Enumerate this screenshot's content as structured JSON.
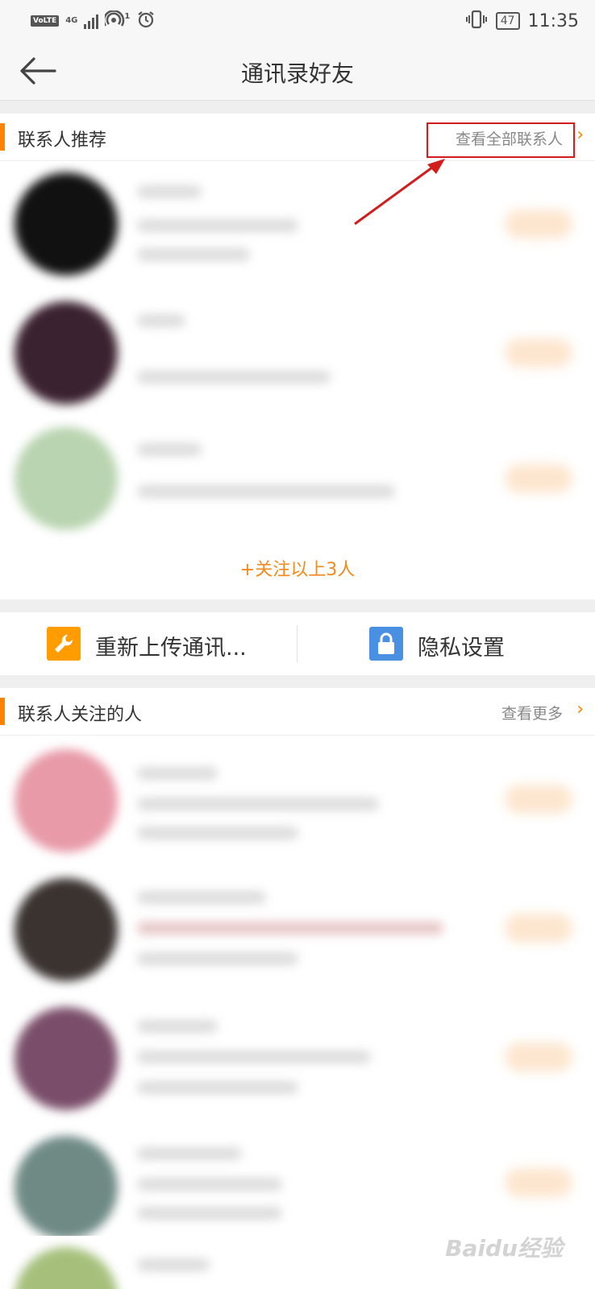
{
  "status_bar": {
    "volte": "VoLTE",
    "network": "4G",
    "hotspot_count": "1",
    "battery": "47",
    "time": "11:35"
  },
  "nav": {
    "title": "通讯录好友"
  },
  "recommend_section": {
    "title": "联系人推荐",
    "more_label": "查看全部联系人",
    "follow_all_label": "+关注以上3人"
  },
  "tools": {
    "reupload_label": "重新上传通讯...",
    "privacy_label": "隐私设置"
  },
  "following_section": {
    "title": "联系人关注的人",
    "more_label": "查看更多"
  },
  "watermark": "Baidu经验",
  "colors": {
    "accent": "#ff8200",
    "annotation_red": "#d21d1d",
    "tool_orange": "#ff9c00",
    "tool_blue": "#4a90e2"
  }
}
